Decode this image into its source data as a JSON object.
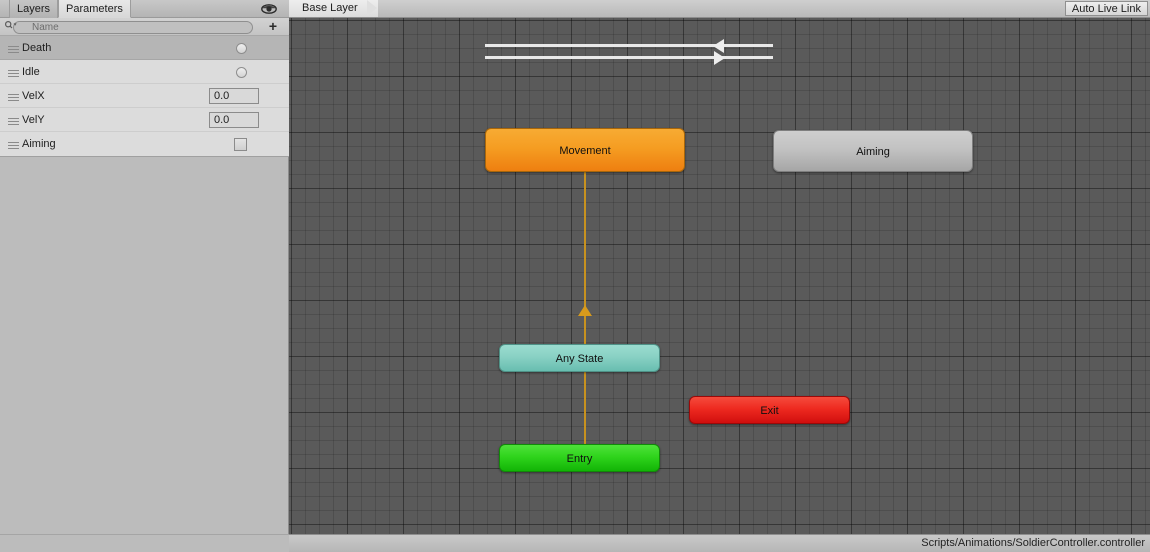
{
  "window": {
    "status_path": "Scripts/Animations/SoldierController.controller"
  },
  "left_panel": {
    "tabs": [
      {
        "label": "Layers",
        "active": false
      },
      {
        "label": "Parameters",
        "active": true
      }
    ],
    "eye_icon": "eye-icon",
    "search": {
      "placeholder": "Name",
      "value": "",
      "icon": "search-icon",
      "add_label": "+"
    },
    "parameters": [
      {
        "name": "Death",
        "type": "trigger",
        "value": "",
        "selected": true
      },
      {
        "name": "Idle",
        "type": "trigger",
        "value": "",
        "selected": false
      },
      {
        "name": "VelX",
        "type": "float",
        "value": "0.0",
        "selected": false
      },
      {
        "name": "VelY",
        "type": "float",
        "value": "0.0",
        "selected": false
      },
      {
        "name": "Aiming",
        "type": "bool",
        "value": "",
        "selected": false
      }
    ]
  },
  "graph": {
    "toolbar": {
      "breadcrumb": "Base Layer",
      "live_link_label": "Auto Live Link"
    },
    "nodes": [
      {
        "id": "movement",
        "label": "Movement",
        "kind": "movement"
      },
      {
        "id": "aiming",
        "label": "Aiming",
        "kind": "aiming"
      },
      {
        "id": "any-state",
        "label": "Any State",
        "kind": "anystate"
      },
      {
        "id": "exit",
        "label": "Exit",
        "kind": "exit"
      },
      {
        "id": "entry",
        "label": "Entry",
        "kind": "entry"
      }
    ],
    "transitions": [
      {
        "from": "aiming",
        "to": "movement",
        "color": "#ededed"
      },
      {
        "from": "movement",
        "to": "aiming",
        "color": "#ededed"
      },
      {
        "from": "entry",
        "to": "movement",
        "color": "#c8921f"
      }
    ]
  },
  "colors": {
    "movement": "#f59d22",
    "aiming": "#c2c2c2",
    "any_state": "#89d1c4",
    "entry": "#2fd41c",
    "exit": "#ee2a20",
    "graph_bg": "#5a5a5a",
    "panel_bg": "#bcbcbc"
  }
}
